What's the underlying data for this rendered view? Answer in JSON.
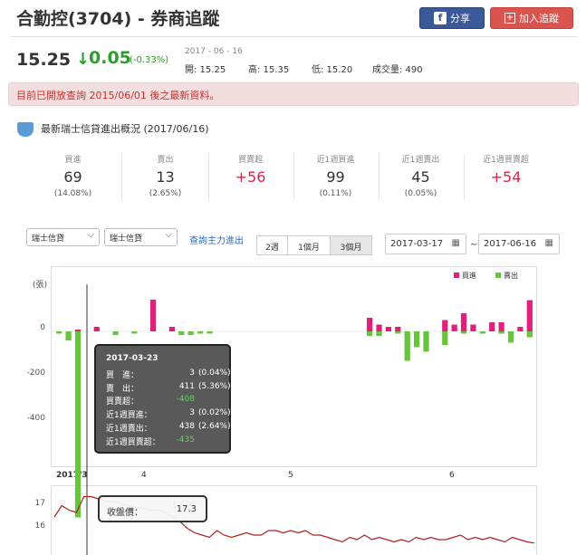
{
  "header": {
    "title": "合勤控(3704) - 券商追蹤",
    "share_label": "分享",
    "track_label": "加入追蹤",
    "facebook_icon_text": "f",
    "add_icon_text": "+"
  },
  "quote": {
    "price": "15.25",
    "change_arrow": "↓",
    "change": "0.05",
    "change_pct": "(-0.33%)",
    "date": "2017 - 06 - 16",
    "open": "開: 15.25",
    "high": "高: 15.35",
    "low": "低: 15.20",
    "volume": "成交量: 490"
  },
  "notice": "目前已開放查詢 2015/06/01 後之最新資料。",
  "section": {
    "title": "最新瑞士信貸進出概況 (2017/06/16)"
  },
  "stats": [
    {
      "label": "買進",
      "value": "69",
      "sub": "(14.08%)"
    },
    {
      "label": "賣出",
      "value": "13",
      "sub": "(2.65%)"
    },
    {
      "label": "買賣超",
      "value": "+56",
      "sub": ""
    },
    {
      "label": "近1週買進",
      "value": "99",
      "sub": "(0.11%)"
    },
    {
      "label": "近1週賣出",
      "value": "45",
      "sub": "(0.05%)"
    },
    {
      "label": "近1週買賣超",
      "value": "+54",
      "sub": ""
    }
  ],
  "controls": {
    "broker_select_1": "瑞士信貸",
    "broker_select_2": "瑞士信貸",
    "query_link": "查詢主力進出",
    "tabs": [
      "2週",
      "1個月",
      "3個月"
    ],
    "active_tab": "3個月",
    "start_date": "2017-03-17",
    "end_date": "2017-06-16",
    "tilde": "~",
    "calendar_icon": "▦",
    "caret": "⌵"
  },
  "colors": {
    "buy": "#e0207a",
    "sell": "#66c53a",
    "price_line": "#b02020",
    "red_value": "#e0204a"
  },
  "chart_data": [
    {
      "type": "bar",
      "ylabel": "(張)",
      "yticks": [
        0,
        -200,
        -400
      ],
      "xticks": [
        "2017/3",
        "4",
        "5",
        "6"
      ],
      "legend": [
        "買進",
        "賣出"
      ],
      "legend_position": "top-right",
      "series": [
        {
          "name": "買進",
          "values": [
            0,
            0,
            3,
            0,
            10,
            0,
            0,
            0,
            0,
            0,
            70,
            0,
            10,
            0,
            0,
            0,
            0,
            0,
            0,
            0,
            0,
            0,
            0,
            0,
            0,
            0,
            0,
            0,
            0,
            0,
            0,
            0,
            0,
            30,
            15,
            10,
            10,
            0,
            0,
            0,
            0,
            25,
            15,
            40,
            15,
            0,
            20,
            20,
            0,
            10,
            69
          ]
        },
        {
          "name": "賣出",
          "values": [
            -5,
            -20,
            -411,
            0,
            0,
            0,
            -8,
            0,
            -5,
            0,
            0,
            0,
            0,
            -8,
            -8,
            -5,
            -5,
            0,
            0,
            0,
            0,
            0,
            0,
            0,
            0,
            0,
            0,
            0,
            0,
            0,
            0,
            0,
            0,
            -10,
            -10,
            0,
            -5,
            -65,
            -35,
            -45,
            0,
            -30,
            0,
            -5,
            0,
            -5,
            0,
            -5,
            -25,
            0,
            -13
          ]
        }
      ]
    },
    {
      "type": "line",
      "name": "收盤價",
      "yticks": [
        17,
        16
      ],
      "values": [
        16.4,
        16.9,
        16.7,
        16.6,
        17.3,
        17.3,
        17.2,
        17.1,
        17.1,
        17.0,
        16.9,
        16.8,
        16.8,
        16.7,
        16.7,
        16.6,
        16.4,
        16.2,
        15.9,
        15.7,
        15.6,
        15.5,
        15.8,
        15.6,
        15.5,
        15.6,
        15.7,
        15.6,
        15.6,
        15.8,
        15.8,
        15.7,
        15.8,
        15.7,
        15.8,
        15.6,
        15.6,
        15.5,
        15.4,
        15.3,
        15.5,
        15.4,
        15.6,
        15.4,
        15.5,
        15.4,
        15.3,
        15.4,
        15.3,
        15.5,
        15.4,
        15.5,
        15.4,
        15.4,
        15.5,
        15.6,
        15.4,
        15.5,
        15.4,
        15.5,
        15.4,
        15.3,
        15.5,
        15.4,
        15.3,
        15.25
      ]
    }
  ],
  "tooltip": {
    "date": "2017-03-23",
    "rows": [
      {
        "key": "買　進：",
        "value": "3",
        "pct": "(0.04%)"
      },
      {
        "key": "賣　出：",
        "value": "411",
        "pct": "(5.36%)"
      },
      {
        "key": "買賣超：",
        "value": "-408",
        "pct": ""
      },
      {
        "key": "近1週買進：",
        "value": "3",
        "pct": "(0.02%)"
      },
      {
        "key": "近1週賣出：",
        "value": "438",
        "pct": "(2.64%)"
      },
      {
        "key": "近1週買賣超：",
        "value": "-435",
        "pct": ""
      }
    ]
  },
  "price_tooltip": {
    "label": "收盤價：",
    "value": "17.3"
  }
}
